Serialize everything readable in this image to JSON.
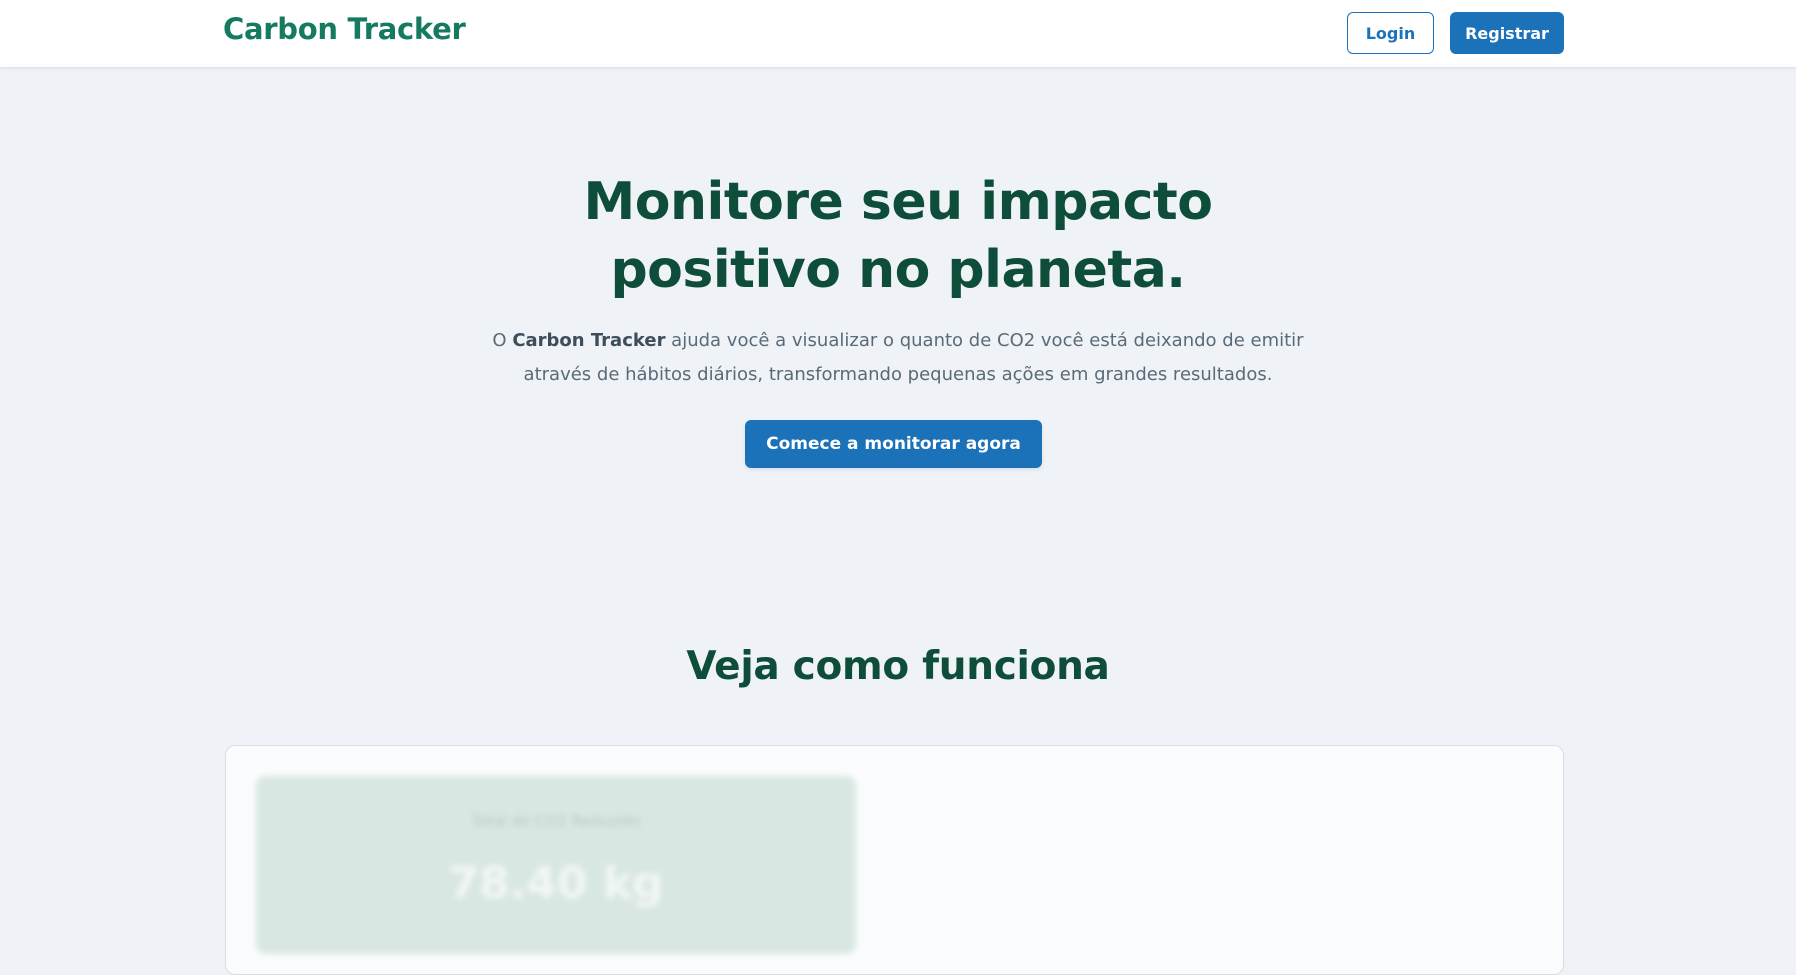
{
  "header": {
    "brand": "Carbon Tracker",
    "login_label": "Login",
    "register_label": "Registrar"
  },
  "hero": {
    "title_line1": "Monitore seu impacto",
    "title_line2": "positivo no planeta.",
    "subtitle_prefix": "O ",
    "subtitle_brand": "Carbon Tracker",
    "subtitle_rest_line1": " ajuda você a visualizar o quanto de CO2 você está deixando de emitir",
    "subtitle_line2": "através de hábitos diários, transformando pequenas ações em grandes resultados.",
    "cta_label": "Comece a monitorar agora"
  },
  "how_it_works": {
    "title": "Veja como funciona",
    "stat_label": "Total de CO2 Reduzido",
    "stat_value": "78.40 kg"
  },
  "colors": {
    "brand_green": "#157a60",
    "heading_green": "#0f4d3b",
    "primary_blue": "#1c72b8",
    "background": "#eff3f7"
  }
}
